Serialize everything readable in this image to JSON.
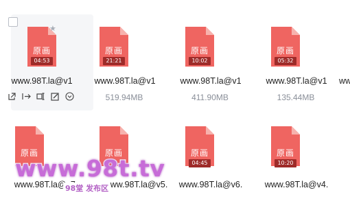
{
  "colors": {
    "file_red": "#ef6561",
    "file_fold": "#f7b2ad",
    "duration_bg": "#9e2b29",
    "watermark": "#c76cd8"
  },
  "files": [
    {
      "badge": "原画",
      "duration": "04:53",
      "name": "www.98T.la@v1",
      "size": ""
    },
    {
      "badge": "原画",
      "duration": "21:21",
      "name": "www.98T.la@v1",
      "size": "519.94MB"
    },
    {
      "badge": "原画",
      "duration": "10:02",
      "name": "www.98T.la@v1",
      "size": "411.90MB"
    },
    {
      "badge": "原画",
      "duration": "05:32",
      "name": "www.98T.la@v1",
      "size": "135.44MB"
    },
    {
      "badge": "",
      "duration": "",
      "name": "www",
      "size": ""
    },
    {
      "badge": "原画",
      "duration": "",
      "name": "www.98T.la@v7.",
      "size": ""
    },
    {
      "badge": "原画",
      "duration": "",
      "name": "www.98T.la@v5.",
      "size": ""
    },
    {
      "badge": "原画",
      "duration": "04:45",
      "name": "www.98T.la@v6.",
      "size": ""
    },
    {
      "badge": "原画",
      "duration": "10:20",
      "name": "www.98T.la@v4.",
      "size": ""
    }
  ],
  "actions": [
    "share-icon",
    "move-icon",
    "rename-icon",
    "edit-icon",
    "more-icon"
  ],
  "watermark": {
    "main": "www.98t.tv",
    "sub": "98堂 发布区"
  }
}
